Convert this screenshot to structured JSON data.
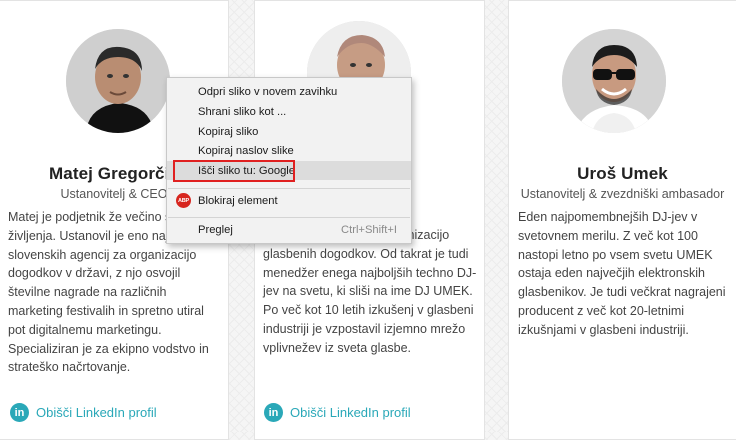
{
  "cards": [
    {
      "name": "Matej Gregorčič",
      "role": "Ustanovitelj & CEO",
      "bio": "Matej je podjetnik že večino svojega življenja. Ustanovil je eno največjih slovenskih agencij za organizacijo dogodkov v državi, z njo osvojil številne nagrade na različnih marketing festivalih in spretno utiral pot digitalnemu marketingu. Specializiran je za ekipno vodstvo in strateško načrtovanje.",
      "link_label": "Obišči LinkedIn profil"
    },
    {
      "name": "",
      "role": "",
      "bio": "ustanovil agencijo za organizacijo glasbenih dogodkov. Od takrat je tudi menedžer enega najboljših techno DJ-jev na svetu, ki sliši na ime DJ UMEK. Po več kot 10 letih izkušenj v glasbeni industriji je vzpostavil izjemno mrežo vplivnežev iz sveta glasbe.",
      "link_label": "Obišči LinkedIn profil"
    },
    {
      "name": "Uroš Umek",
      "role": "Ustanovitelj & zvezdniški ambasador",
      "bio": "Eden najpomembnejših DJ-jev v svetovnem merilu. Z več kot 100 nastopi letno po vsem svetu UMEK ostaja eden največjih elektronskih glasbenikov. Je tudi večkrat nagrajeni producent z več kot 20-letnimi izkušnjami v glasbeni industriji.",
      "link_label": ""
    }
  ],
  "linkedin_icon_text": "in",
  "context_menu": {
    "items": [
      {
        "label": "Odpri sliko v novem zavihku"
      },
      {
        "label": "Shrani sliko kot ..."
      },
      {
        "label": "Kopiraj sliko"
      },
      {
        "label": "Kopiraj naslov slike"
      },
      {
        "label": "Išči sliko tu: Google",
        "highlighted": true
      },
      {
        "label": "Blokiraj element",
        "icon": "adblock-plus-icon",
        "icon_text": "ABP"
      },
      {
        "label": "Preglej",
        "shortcut": "Ctrl+Shift+I"
      }
    ]
  },
  "colors": {
    "accent": "#2aa8b8",
    "highlight_border": "#e02020",
    "adblock_red": "#d7261f"
  }
}
